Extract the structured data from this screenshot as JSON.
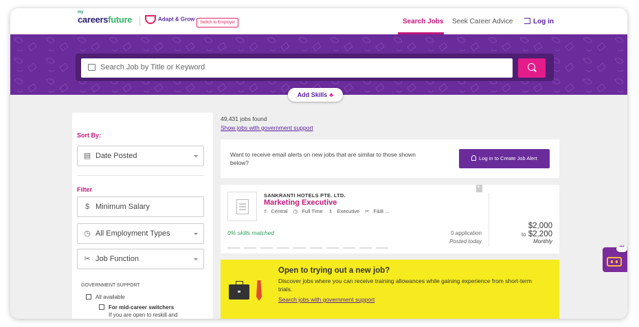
{
  "header": {
    "logo_my": "my",
    "logo_careers": "careers",
    "logo_future": "future",
    "adapt_label": "Adapt & Grow",
    "switch_label": "Switch to Employer",
    "nav": {
      "search_jobs": "Search Jobs",
      "seek_advice": "Seek Career Advice",
      "login": "Log in"
    }
  },
  "search": {
    "placeholder": "Search Job by Title or Keyword",
    "add_skills": "Add Skills"
  },
  "sidebar": {
    "sort_by_label": "Sort By:",
    "sort_value": "Date Posted",
    "filter_label": "Filter",
    "min_salary": "Minimum Salary",
    "employment_types": "All Employment Types",
    "job_function": "Job Function",
    "gov_support_title": "GOVERNMENT SUPPORT",
    "gov_options": {
      "all_available": "All available",
      "mid_career": "For mid-career switchers",
      "mid_career_desc1": "If you are open to reskill and"
    }
  },
  "results": {
    "count": "49,431 jobs found",
    "gov_link": "Show jobs with government support",
    "alert_text": "Want to receive email alerts on new jobs that are similar to those shown below?",
    "alert_button": "Log in to Create Job Alert"
  },
  "job": {
    "company": "SANKRANTI HOTELS PTE. LTD.",
    "title": "Marketing Executive",
    "location": "Central",
    "type": "Full Time",
    "level": "Executive",
    "category": "F&B ...",
    "skills_match": "0% skills matched",
    "applications": "0 application",
    "posted": "Posted today",
    "salary_min": "$2,000",
    "salary_to": "to",
    "salary_max": "$2,200",
    "salary_period": "Monthly"
  },
  "promo": {
    "heading": "Open to trying out a new job?",
    "description": "Discover jobs where you can receive training allowances while gaining experience from short-term trials.",
    "link": "Search jobs with government support"
  },
  "colors": {
    "purple": "#6a2b9b",
    "pink": "#c2187a",
    "yellow": "#f5eb1e"
  }
}
